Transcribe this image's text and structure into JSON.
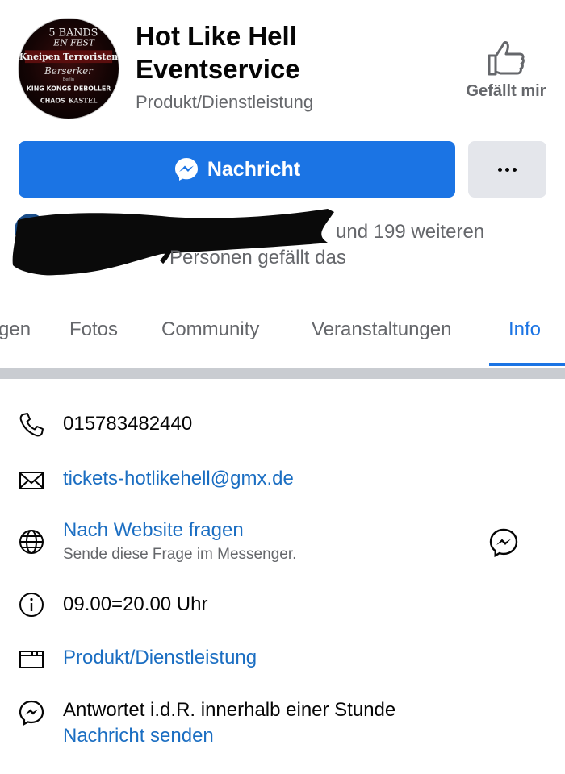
{
  "header": {
    "title_line1": "Hot Like Hell",
    "title_line2": "Eventservice",
    "category": "Produkt/Dienstleistung",
    "like_label": "Gefällt mir",
    "avatar_lines": [
      "5 BANDS",
      "EN FEST",
      "Kneipen Terroristen",
      "Berserker",
      "Berlin",
      "KING KONGS DEBOLLER",
      "CHAOS",
      "KASTEL"
    ]
  },
  "actions": {
    "message_label": "Nachricht",
    "accent_color": "#1b74e4"
  },
  "likes": {
    "line1": "und 199 weiteren",
    "line2": "Personen gefällt das"
  },
  "tabs": [
    {
      "label": "gen"
    },
    {
      "label": "Fotos"
    },
    {
      "label": "Community"
    },
    {
      "label": "Veranstaltungen"
    },
    {
      "label": "Info",
      "active": true
    }
  ],
  "info": {
    "phone": "015783482440",
    "email": "tickets-hotlikehell@gmx.de",
    "website_ask": "Nach Website fragen",
    "website_ask_sub": "Sende diese Frage im Messenger.",
    "hours": "09.00=20.00 Uhr",
    "category": "Produkt/Dienstleistung",
    "response": "Antwortet i.d.R. innerhalb einer Stunde",
    "send_message": "Nachricht senden"
  }
}
